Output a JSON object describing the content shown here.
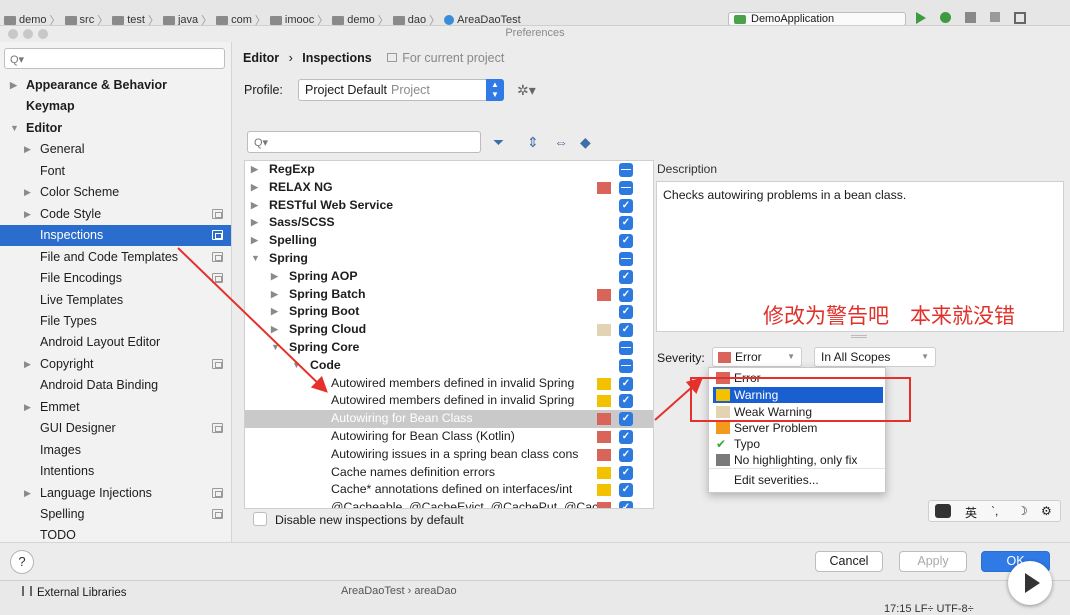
{
  "ide": {
    "breadcrumb": [
      "demo",
      "src",
      "test",
      "java",
      "com",
      "imooc",
      "demo",
      "dao",
      "AreaDaoTest"
    ],
    "run_config": "DemoApplication",
    "window_title": "Preferences"
  },
  "sidebar": {
    "search_placeholder": "",
    "items": [
      {
        "label": "Appearance & Behavior",
        "bold": true,
        "arrow": "right",
        "indent": 0
      },
      {
        "label": "Keymap",
        "bold": true,
        "indent": 0
      },
      {
        "label": "Editor",
        "bold": true,
        "arrow": "down",
        "indent": 0
      },
      {
        "label": "General",
        "arrow": "right",
        "indent": 1
      },
      {
        "label": "Font",
        "indent": 1
      },
      {
        "label": "Color Scheme",
        "arrow": "right",
        "indent": 1
      },
      {
        "label": "Code Style",
        "arrow": "right",
        "indent": 1,
        "copy": true
      },
      {
        "label": "Inspections",
        "indent": 1,
        "copy": true,
        "selected": true
      },
      {
        "label": "File and Code Templates",
        "indent": 1,
        "copy": true
      },
      {
        "label": "File Encodings",
        "indent": 1,
        "copy": true
      },
      {
        "label": "Live Templates",
        "indent": 1
      },
      {
        "label": "File Types",
        "indent": 1
      },
      {
        "label": "Android Layout Editor",
        "indent": 1
      },
      {
        "label": "Copyright",
        "arrow": "right",
        "indent": 1,
        "copy": true
      },
      {
        "label": "Android Data Binding",
        "indent": 1
      },
      {
        "label": "Emmet",
        "arrow": "right",
        "indent": 1
      },
      {
        "label": "GUI Designer",
        "indent": 1,
        "copy": true
      },
      {
        "label": "Images",
        "indent": 1
      },
      {
        "label": "Intentions",
        "indent": 1
      },
      {
        "label": "Language Injections",
        "arrow": "right",
        "indent": 1,
        "copy": true
      },
      {
        "label": "Spelling",
        "indent": 1,
        "copy": true
      },
      {
        "label": "TODO",
        "indent": 1
      }
    ]
  },
  "header": {
    "crumb_editor": "Editor",
    "crumb_sep": "›",
    "crumb_page": "Inspections",
    "scope_note": "For current project",
    "profile_label": "Profile:",
    "profile_value": "Project Default",
    "profile_sub": "Project"
  },
  "tree": {
    "rows": [
      {
        "label": "RegExp",
        "bold": true,
        "tri": "right",
        "level": 0,
        "sev": null,
        "check": "minus"
      },
      {
        "label": "RELAX NG",
        "bold": true,
        "tri": "right",
        "level": 0,
        "sev": "#d9645a",
        "check": "minus"
      },
      {
        "label": "RESTful Web Service",
        "bold": true,
        "tri": "right",
        "level": 0,
        "sev": null,
        "check": "check"
      },
      {
        "label": "Sass/SCSS",
        "bold": true,
        "tri": "right",
        "level": 0,
        "sev": null,
        "check": "check"
      },
      {
        "label": "Spelling",
        "bold": true,
        "tri": "right",
        "level": 0,
        "sev": null,
        "check": "check"
      },
      {
        "label": "Spring",
        "bold": true,
        "tri": "down",
        "level": 0,
        "sev": null,
        "check": "minus"
      },
      {
        "label": "Spring AOP",
        "bold": true,
        "tri": "right",
        "level": 1,
        "sev": null,
        "check": "check"
      },
      {
        "label": "Spring Batch",
        "bold": true,
        "tri": "right",
        "level": 1,
        "sev": "#d9645a",
        "check": "check"
      },
      {
        "label": "Spring Boot",
        "bold": true,
        "tri": "right",
        "level": 1,
        "sev": null,
        "check": "check"
      },
      {
        "label": "Spring Cloud",
        "bold": true,
        "tri": "right",
        "level": 1,
        "sev": "#e2d3b3",
        "check": "check"
      },
      {
        "label": "Spring Core",
        "bold": true,
        "tri": "down",
        "level": 1,
        "sev": null,
        "check": "minus"
      },
      {
        "label": "Code",
        "bold": true,
        "tri": "down",
        "level": 2,
        "sev": null,
        "check": "minus"
      },
      {
        "label": "Autowired members defined in invalid Spring",
        "level": 3,
        "sev": "#f2c200",
        "check": "check"
      },
      {
        "label": "Autowired members defined in invalid Spring",
        "level": 3,
        "sev": "#f2c200",
        "check": "check"
      },
      {
        "label": "Autowiring for Bean Class",
        "level": 3,
        "sev": "#d9645a",
        "check": "check",
        "selected": true
      },
      {
        "label": "Autowiring for Bean Class (Kotlin)",
        "level": 3,
        "sev": "#d9645a",
        "check": "check"
      },
      {
        "label": "Autowiring issues in a spring bean class cons",
        "level": 3,
        "sev": "#d9645a",
        "check": "check"
      },
      {
        "label": "Cache names definition errors",
        "level": 3,
        "sev": "#f2c200",
        "check": "check"
      },
      {
        "label": "Cache* annotations defined on interfaces/int",
        "level": 3,
        "sev": "#f2c200",
        "check": "check"
      },
      {
        "label": "@Cacheable, @CacheEvict, @CachePut, @Cach",
        "level": 3,
        "sev": "#d9645a",
        "check": "check"
      }
    ]
  },
  "description": {
    "label": "Description",
    "text": "Checks autowiring problems in a bean class.",
    "annotation": "修改为警告吧　本来就没错"
  },
  "severity": {
    "label": "Severity:",
    "value": "Error",
    "value_color": "#d9645a",
    "scope": "In All Scopes",
    "options": [
      {
        "label": "Error",
        "color": "#d9645a"
      },
      {
        "label": "Warning",
        "color": "#f2c200",
        "selected": true
      },
      {
        "label": "Weak Warning",
        "color": "#e2d3b3"
      },
      {
        "label": "Server Problem",
        "color": "#f39a1e"
      },
      {
        "label": "Typo",
        "color": "#3aa63a",
        "icon": "typo-check"
      },
      {
        "label": "No highlighting, only fix",
        "color": "#7a7a7a"
      }
    ],
    "edit_label": "Edit severities..."
  },
  "disable_new": "Disable new inspections by default",
  "ime": {
    "lang": "英"
  },
  "buttons": {
    "help": "?",
    "cancel": "Cancel",
    "apply": "Apply",
    "ok": "OK"
  },
  "bottom": {
    "external_libraries": "External Libraries",
    "file_crumb": "AreaDaoTest  ›  areaDao",
    "status": "17:15  LF÷  UTF-8÷"
  },
  "accent": "#2b6dcc",
  "annotation_color": "#e5302b"
}
